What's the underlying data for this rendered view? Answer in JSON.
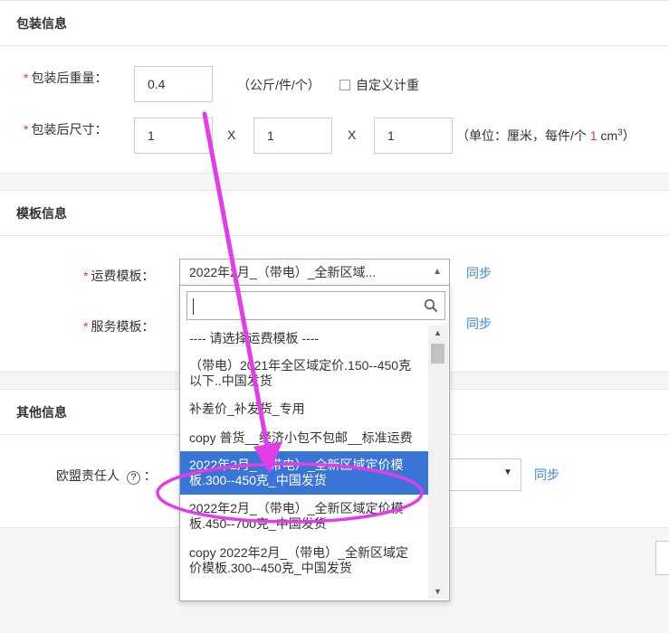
{
  "packaging": {
    "title": "包装信息",
    "weight_label": "包装后重量：",
    "weight_value": "0.4",
    "weight_unit": "（公斤/件/个）",
    "custom_weight_label": "自定义计重",
    "size_label": "包装后尺寸：",
    "length": "1",
    "width": "1",
    "height": "1",
    "times": "X",
    "size_unit_prefix": "（单位：厘米，每件/个 ",
    "size_unit_num": "1",
    "size_unit_suffix": " cm",
    "size_unit_sup": "3",
    "size_unit_close": "）"
  },
  "template": {
    "title": "模板信息",
    "shipping_label": "运费模板：",
    "shipping_selected": "2022年2月_（带电）_全新区域...",
    "service_label": "服务模板：",
    "sync_label": "同步",
    "search_value": "",
    "options": [
      "---- 请选择运费模板 ----",
      "（带电）2021年全区域定价.150--450克以下..中国发货",
      "补差价_补发货_专用",
      "copy 普货__经济小包不包邮__标准运费",
      "2022年2月_（带电）_全新区域定价模板.300--450克_中国发货",
      "2022年2月_（带电）_全新区域定价模板.450--700克_中国发货",
      "copy 2022年2月_（带电）_全新区域定价模板.300--450克_中国发货"
    ],
    "selected_index": 4
  },
  "other": {
    "title": "其他信息",
    "eu_label": "欧盟责任人",
    "help_icon": "?",
    "sync_label": "同步"
  },
  "colors": {
    "required": "#e4393c",
    "link": "#3a87d8",
    "highlight": "#3875d7",
    "annotation": "#e23de6"
  }
}
